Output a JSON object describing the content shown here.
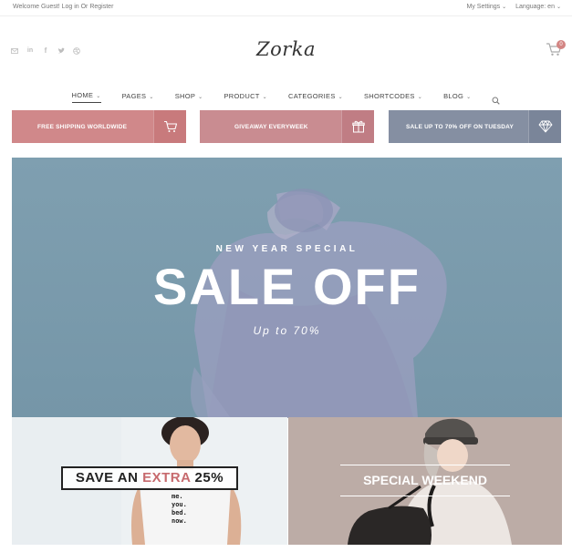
{
  "topbar": {
    "welcome_prefix": "Welcome Guest!",
    "login": "Log in",
    "or": "Or",
    "register": "Register",
    "my_settings": "My Settings",
    "language": "Language: en"
  },
  "social_icons": [
    "mail-icon",
    "linkedin-icon",
    "facebook-icon",
    "twitter-icon",
    "dribbble-icon"
  ],
  "logo": "Zorka",
  "cart": {
    "count": "0"
  },
  "nav": {
    "items": [
      {
        "label": "HOME"
      },
      {
        "label": "PAGES"
      },
      {
        "label": "SHOP"
      },
      {
        "label": "PRODUCT"
      },
      {
        "label": "CATEGORIES"
      },
      {
        "label": "SHORTCODES"
      },
      {
        "label": "BLOG"
      }
    ],
    "active": "HOME"
  },
  "promos": [
    {
      "text": "FREE SHIPPING WORLDWIDE",
      "icon": "cart-icon",
      "color": "#d0888a"
    },
    {
      "text": "GIVEAWAY EVERYWEEK",
      "icon": "gift-icon",
      "color": "#c98c91"
    },
    {
      "text": "SALE UP TO 70% OFF ON TUESDAY",
      "icon": "diamond-icon",
      "color": "#858fa2"
    }
  ],
  "hero": {
    "kicker": "NEW YEAR SPECIAL",
    "title": "SALE OFF",
    "subtitle": "Up to 70%",
    "color": "#7a9aac"
  },
  "tiles": {
    "left": {
      "text_a": "SAVE AN ",
      "text_highlight": "EXTRA",
      "text_b": " 25%",
      "shirt_lines": [
        "me.",
        "you.",
        "bed.",
        "now."
      ],
      "highlight_color": "#c76a6e"
    },
    "right": {
      "text": "SPECIAL WEEKEND"
    }
  }
}
